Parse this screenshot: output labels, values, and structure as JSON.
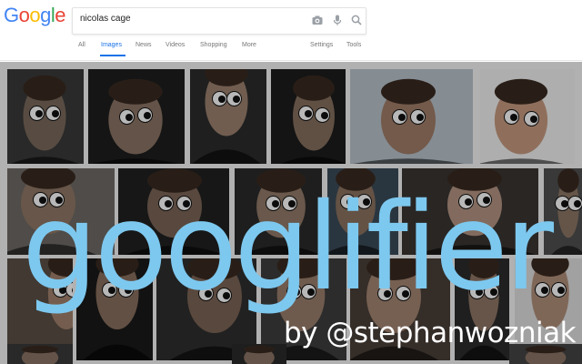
{
  "header": {
    "logo_letters": [
      {
        "char": "G",
        "color": "#4285f4"
      },
      {
        "char": "o",
        "color": "#ea4335"
      },
      {
        "char": "o",
        "color": "#fbbc05"
      },
      {
        "char": "g",
        "color": "#4285f4"
      },
      {
        "char": "l",
        "color": "#34a853"
      },
      {
        "char": "e",
        "color": "#ea4335"
      }
    ],
    "search_value": "nicolas cage",
    "search_icons": [
      "camera-icon",
      "microphone-icon",
      "search-icon"
    ],
    "tabs": [
      {
        "label": "All",
        "active": false
      },
      {
        "label": "Images",
        "active": true
      },
      {
        "label": "News",
        "active": false
      },
      {
        "label": "Videos",
        "active": false
      },
      {
        "label": "Shopping",
        "active": false
      },
      {
        "label": "More",
        "active": false
      },
      {
        "label": "Settings",
        "active": false
      },
      {
        "label": "Tools",
        "active": false
      }
    ]
  },
  "overlay": {
    "title": "googlifier",
    "byline": "by @stephanwozniak",
    "title_color": "#7dc8ef",
    "byline_color": "#ffffff"
  }
}
